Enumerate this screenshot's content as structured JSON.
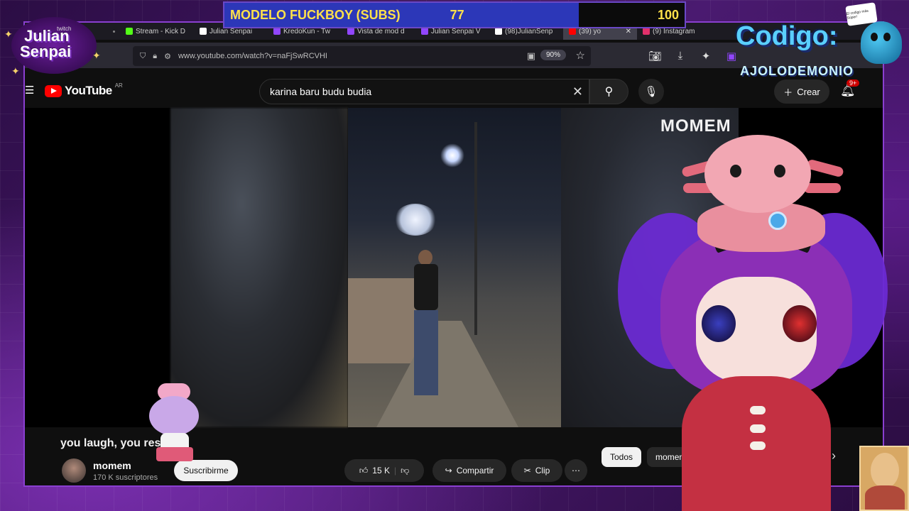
{
  "overlay": {
    "sub_goal": {
      "title": "MODELO FUCKBOY (SUBS)",
      "current": "77",
      "goal": "100",
      "progress": 0.77,
      "fill_color": "#2c37b8",
      "text_color": "#ffe14a"
    },
    "streamer_logo": {
      "line1": "Julian",
      "line2": "Senpai",
      "tag": "twitch"
    },
    "code_banner": {
      "line1": "Codigo:",
      "line2": "AJOLODEMONIO"
    },
    "sticker_note": "El codigo más Súper!"
  },
  "browser": {
    "tabs": [
      {
        "label": "",
        "icon": "dot-icon"
      },
      {
        "label": "Stream - Kick D",
        "icon": "kick-icon",
        "color": "#53fc18"
      },
      {
        "label": "Julian Senpai",
        "icon": "x-icon",
        "color": "#ffffff"
      },
      {
        "label": "KredoKun - Tw",
        "icon": "twitch-icon",
        "color": "#9146ff"
      },
      {
        "label": "Vista de mod d",
        "icon": "twitch-icon",
        "color": "#9146ff"
      },
      {
        "label": "Julian Senpai V",
        "icon": "twitch-icon",
        "color": "#9146ff"
      },
      {
        "label": "(98)JulianSenp",
        "icon": "tiktok-icon",
        "color": "#ffffff"
      },
      {
        "label": "(39) yo",
        "icon": "youtube-icon",
        "color": "#ff0000",
        "active": true
      },
      {
        "label": "(9) Instagram",
        "icon": "instagram-icon",
        "color": "#e1306c"
      }
    ],
    "url": "www.youtube.com/watch?v=naFjSwRCVHI",
    "zoom": "90%"
  },
  "youtube": {
    "logo_text": "YouTube",
    "region": "AR",
    "search_value": "karina baru budu budia",
    "create_label": "Crear",
    "notifications_badge": "9+",
    "video_overlay_label": "MOMEM",
    "video_title": "you laugh, you res",
    "channel": {
      "name": "momem",
      "subscribers": "170 K suscriptores",
      "subscribe_label": "Suscribirme"
    },
    "actions": {
      "likes": "15 K",
      "share_label": "Compartir",
      "clip_label": "Clip",
      "more_label": "⋯"
    },
    "chips": [
      {
        "label": "Todos",
        "active": true
      },
      {
        "label": "momem",
        "active": false
      }
    ]
  }
}
